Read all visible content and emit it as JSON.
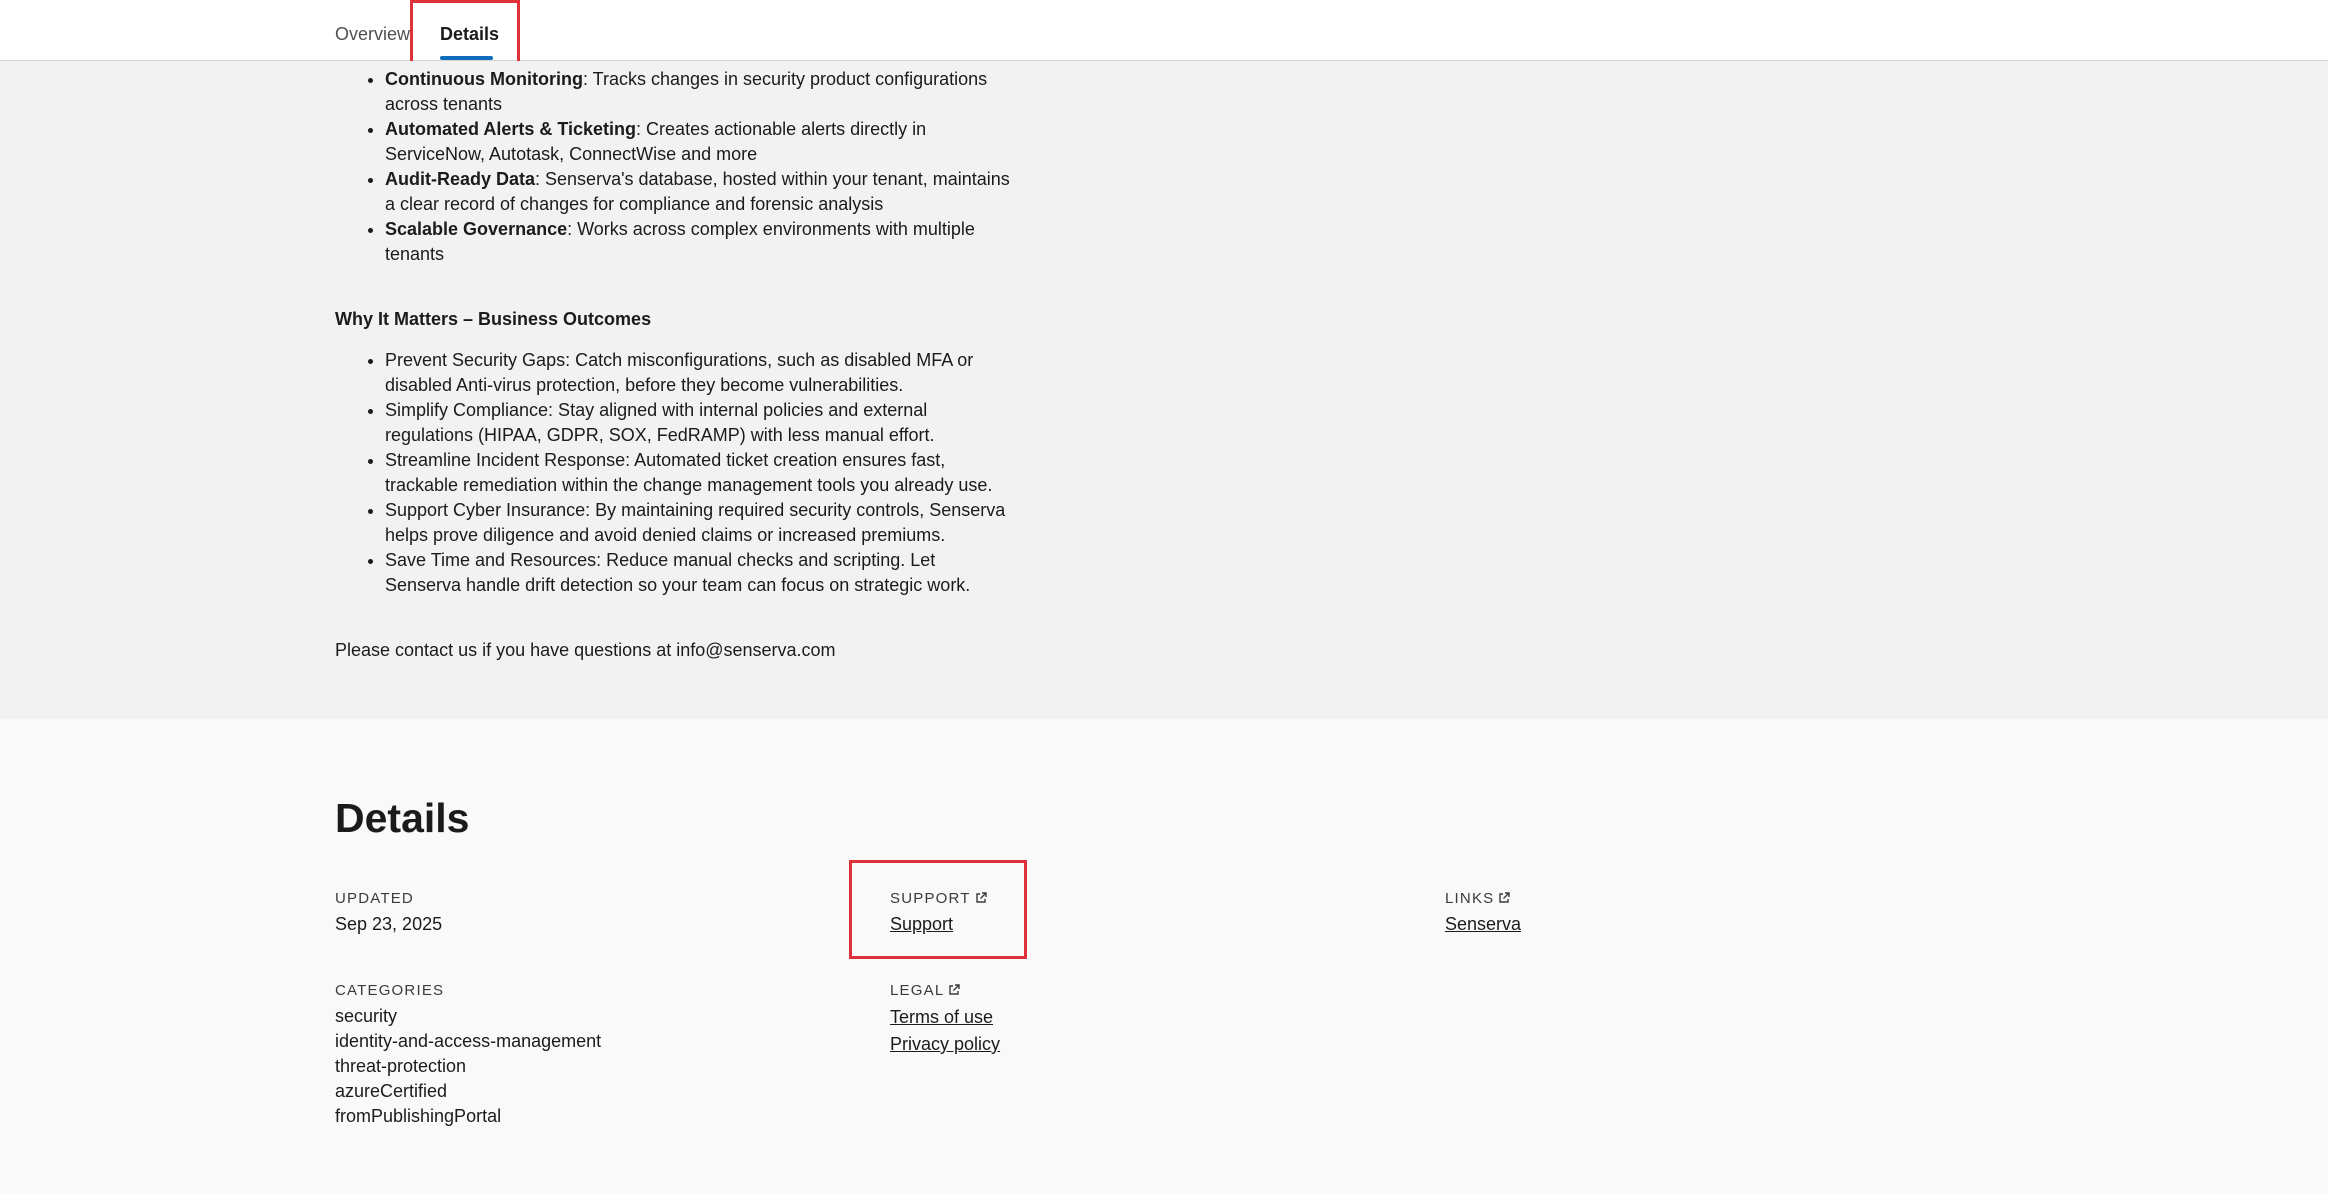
{
  "tabs": [
    {
      "label": "Overview",
      "active": false
    },
    {
      "label": "Details",
      "active": true
    }
  ],
  "description": {
    "features": [
      {
        "title": "Continuous Monitoring",
        "text": ": Tracks changes in security product configurations across tenants"
      },
      {
        "title": "Automated Alerts & Ticketing",
        "text": ": Creates actionable alerts directly in ServiceNow, Autotask, ConnectWise and more"
      },
      {
        "title": "Audit-Ready Data",
        "text": ": Senserva's database, hosted within your tenant, maintains a clear record of changes for compliance and forensic analysis"
      },
      {
        "title": "Scalable Governance",
        "text": ": Works across complex environments with multiple tenants"
      }
    ],
    "outcomes_title": "Why It Matters – Business Outcomes",
    "outcomes": [
      "Prevent Security Gaps: Catch misconfigurations, such as disabled MFA or disabled Anti-virus protection, before they become vulnerabilities.",
      "Simplify Compliance: Stay aligned with internal policies and external regulations (HIPAA, GDPR, SOX, FedRAMP) with less manual effort.",
      "Streamline Incident Response: Automated ticket creation ensures fast, trackable remediation within the change management tools you already use.",
      "Support Cyber Insurance: By maintaining required security controls, Senserva helps prove diligence and avoid denied claims or increased premiums.",
      "Save Time and Resources: Reduce manual checks and scripting. Let Senserva handle drift detection so your team can focus on strategic work."
    ],
    "contact": "Please contact us if you have questions at info@senserva.com"
  },
  "details": {
    "title": "Details",
    "updated_label": "UPDATED",
    "updated_value": "Sep 23, 2025",
    "support_label": "SUPPORT",
    "support_link": "Support",
    "links_label": "LINKS",
    "links_link": "Senserva",
    "categories_label": "CATEGORIES",
    "categories": [
      "security",
      "identity-and-access-management",
      "threat-protection",
      "azureCertified",
      "fromPublishingPortal"
    ],
    "legal_label": "LEGAL",
    "legal_links": [
      "Terms of use",
      "Privacy policy"
    ]
  },
  "colors": {
    "accent": "#0f6cbd",
    "highlight": "#e0303a"
  },
  "icons": [
    "external-link-icon"
  ]
}
